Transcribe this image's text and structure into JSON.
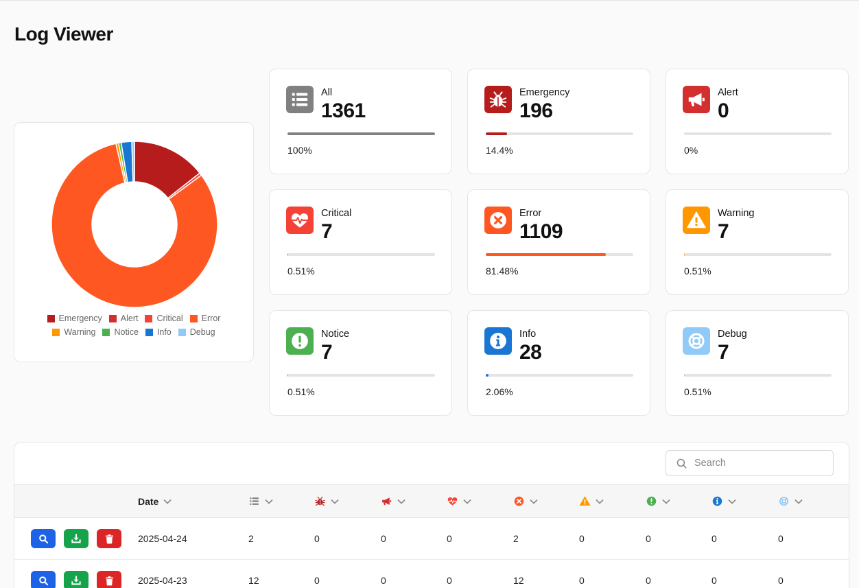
{
  "page": {
    "title": "Log Viewer"
  },
  "colors": {
    "all": "#808080",
    "emergency": "#b71c1c",
    "alert": "#d32f2f",
    "critical": "#f44336",
    "error": "#ff5722",
    "warning": "#ff9800",
    "notice": "#4caf50",
    "info": "#1976d2",
    "debug": "#90caf9",
    "view_button": "#1e62e6",
    "download_button": "#16a34a",
    "delete_button": "#dc2626"
  },
  "chart_data": {
    "type": "pie",
    "categories": [
      "Emergency",
      "Alert",
      "Critical",
      "Error",
      "Warning",
      "Notice",
      "Info",
      "Debug"
    ],
    "values": [
      196,
      0,
      7,
      1109,
      7,
      7,
      28,
      7
    ],
    "colors": [
      "#b71c1c",
      "#d32f2f",
      "#f44336",
      "#ff5722",
      "#ff9800",
      "#4caf50",
      "#1976d2",
      "#90caf9"
    ],
    "legend_position": "bottom"
  },
  "stats": [
    {
      "key": "all",
      "label": "All",
      "count": "1361",
      "percent": "100%",
      "fraction": 1.0,
      "icon": "list-icon"
    },
    {
      "key": "emergency",
      "label": "Emergency",
      "count": "196",
      "percent": "14.4%",
      "fraction": 0.144,
      "icon": "bug-icon"
    },
    {
      "key": "alert",
      "label": "Alert",
      "count": "0",
      "percent": "0%",
      "fraction": 0.0,
      "icon": "bullhorn-icon"
    },
    {
      "key": "critical",
      "label": "Critical",
      "count": "7",
      "percent": "0.51%",
      "fraction": 0.0051,
      "icon": "heartbeat-icon"
    },
    {
      "key": "error",
      "label": "Error",
      "count": "1109",
      "percent": "81.48%",
      "fraction": 0.8148,
      "icon": "times-circle-icon"
    },
    {
      "key": "warning",
      "label": "Warning",
      "count": "7",
      "percent": "0.51%",
      "fraction": 0.0051,
      "icon": "warning-icon"
    },
    {
      "key": "notice",
      "label": "Notice",
      "count": "7",
      "percent": "0.51%",
      "fraction": 0.0051,
      "icon": "exclamation-circle-icon"
    },
    {
      "key": "info",
      "label": "Info",
      "count": "28",
      "percent": "2.06%",
      "fraction": 0.0206,
      "icon": "info-circle-icon"
    },
    {
      "key": "debug",
      "label": "Debug",
      "count": "7",
      "percent": "0.51%",
      "fraction": 0.0051,
      "icon": "life-ring-icon"
    }
  ],
  "table": {
    "search_placeholder": "Search",
    "date_header": "Date",
    "rows": [
      {
        "date": "2025-04-24",
        "all": "2",
        "emergency": "0",
        "alert": "0",
        "critical": "0",
        "error": "2",
        "warning": "0",
        "notice": "0",
        "info": "0",
        "debug": "0"
      },
      {
        "date": "2025-04-23",
        "all": "12",
        "emergency": "0",
        "alert": "0",
        "critical": "0",
        "error": "12",
        "warning": "0",
        "notice": "0",
        "info": "0",
        "debug": "0"
      }
    ]
  }
}
